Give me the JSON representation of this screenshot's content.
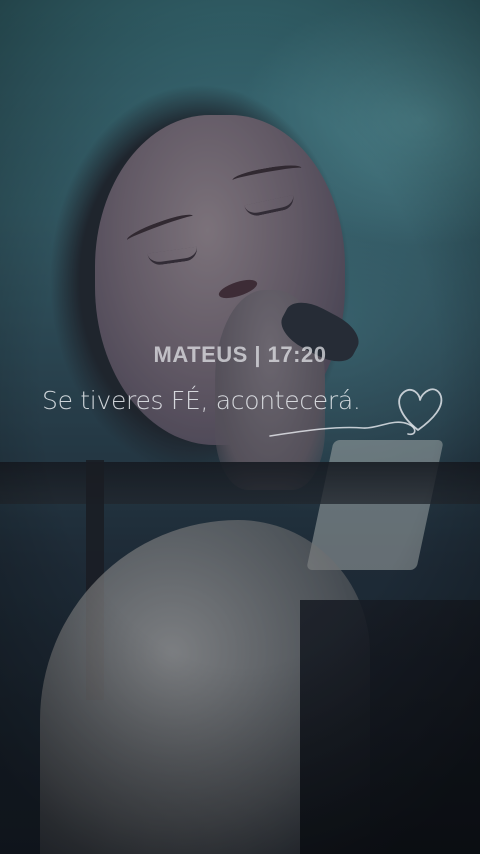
{
  "caption": {
    "header": "MATEUS | 17:20",
    "verse": "Se tiveres FÉ, acontecerá."
  },
  "icons": {
    "heart": "heart-outline-icon"
  },
  "colors": {
    "text": "#e6e8ec",
    "background_tint": "#3a6a73"
  }
}
